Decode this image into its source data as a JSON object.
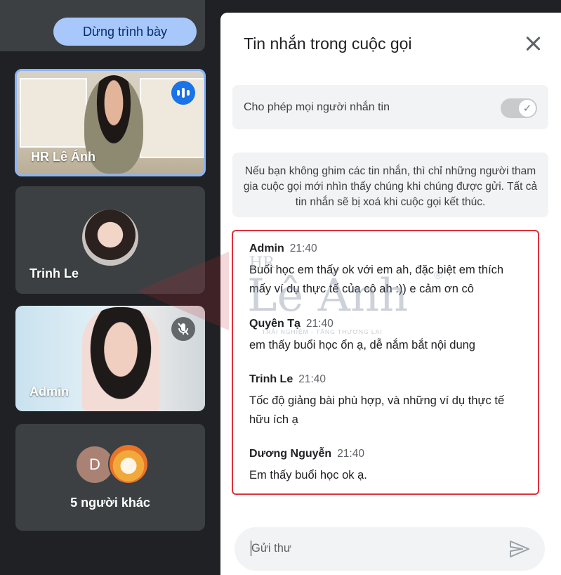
{
  "present_button": {
    "label": "Dừng trình bày"
  },
  "participants": [
    {
      "name": "HR Lê Ánh"
    },
    {
      "name": "Trinh Le"
    },
    {
      "name": "Admin"
    },
    {
      "label": "5 người khác",
      "avatar_initial": "D"
    }
  ],
  "panel": {
    "title": "Tin nhắn trong cuộc gọi",
    "allow_label": "Cho phép mọi người nhắn tin",
    "toggle_state": "on",
    "info_text": "Nếu bạn không ghim các tin nhắn, thì chỉ những người tham gia cuộc gọi mới nhìn thấy chúng khi chúng được gửi. Tất cả tin nhắn sẽ bị xoá khi cuộc gọi kết thúc.",
    "input_placeholder": "Gửi thư"
  },
  "messages": [
    {
      "sender": "Admin",
      "time": "21:40",
      "text": "Buổi học em thấy ok với em ah, đặc biệt em thích mấy ví dụ thực tế của cô ah :)) e cảm ơn cô"
    },
    {
      "sender": "Quyên Tạ",
      "time": "21:40",
      "text": "em thấy buổi học ổn ạ, dễ nắm bắt nội dung"
    },
    {
      "sender": "Trinh Le",
      "time": "21:40",
      "text": "Tốc độ giảng bài phù hợp, và những ví dụ thực tế hữu ích ạ"
    },
    {
      "sender": "Dương Nguyễn",
      "time": "21:40",
      "text": "Em thấy buổi học ok ạ."
    }
  ],
  "watermark": {
    "hr": "HR",
    "brand": "Lê Ánh",
    "tagline": "TRẢI NGHIỆM - TĂNG THƯƠNG LAI",
    "reg": "®"
  },
  "icons": {
    "close": "close-icon",
    "send": "send-icon",
    "mic_off": "mic-off-icon",
    "speaking": "speaking-indicator-icon",
    "check": "check-icon"
  },
  "colors": {
    "accent_button": "#a8c7fa",
    "highlight_border": "#e0303c",
    "tile_active_border": "#8ab4f8"
  }
}
